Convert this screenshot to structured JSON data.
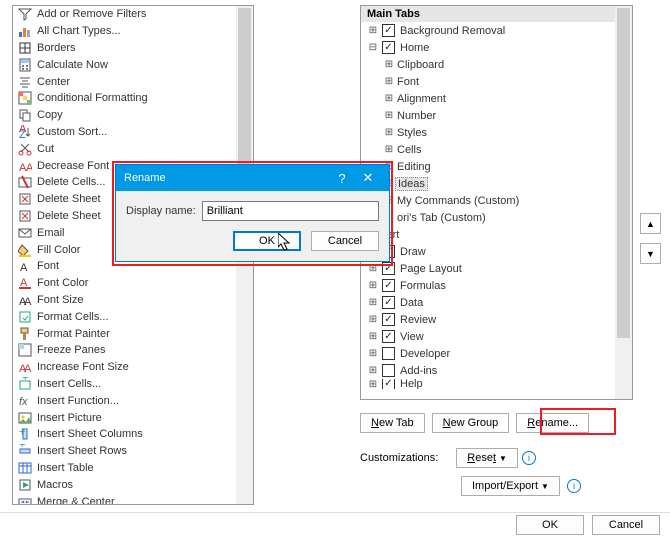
{
  "left_commands": [
    {
      "label": "Add or Remove Filters",
      "icon": "filter"
    },
    {
      "label": "All Chart Types...",
      "icon": "chart"
    },
    {
      "label": "Borders",
      "icon": "borders",
      "hasArrow": true
    },
    {
      "label": "Calculate Now",
      "icon": "calc"
    },
    {
      "label": "Center",
      "icon": "center"
    },
    {
      "label": "Conditional Formatting",
      "icon": "condfmt",
      "hasArrow": true
    },
    {
      "label": "Copy",
      "icon": "copy"
    },
    {
      "label": "Custom Sort...",
      "icon": "sort"
    },
    {
      "label": "Cut",
      "icon": "cut"
    },
    {
      "label": "Decrease Font",
      "icon": "font-dec"
    },
    {
      "label": "Delete Cells...",
      "icon": "del-cells"
    },
    {
      "label": "Delete Sheet",
      "icon": "del-sheet"
    },
    {
      "label": "Delete Sheet",
      "icon": "del-sheet2"
    },
    {
      "label": "Email",
      "icon": "email"
    },
    {
      "label": "Fill Color",
      "icon": "fill"
    },
    {
      "label": "Font",
      "icon": "font"
    },
    {
      "label": "Font Color",
      "icon": "font-color"
    },
    {
      "label": "Font Size",
      "icon": "font-size"
    },
    {
      "label": "Format Cells...",
      "icon": "format-cells"
    },
    {
      "label": "Format Painter",
      "icon": "painter"
    },
    {
      "label": "Freeze Panes",
      "icon": "freeze",
      "hasArrow": true
    },
    {
      "label": "Increase Font Size",
      "icon": "font-inc"
    },
    {
      "label": "Insert Cells...",
      "icon": "ins-cells"
    },
    {
      "label": "Insert Function...",
      "icon": "fx"
    },
    {
      "label": "Insert Picture",
      "icon": "picture"
    },
    {
      "label": "Insert Sheet Columns",
      "icon": "ins-cols"
    },
    {
      "label": "Insert Sheet Rows",
      "icon": "ins-rows"
    },
    {
      "label": "Insert Table",
      "icon": "ins-table"
    },
    {
      "label": "Macros",
      "icon": "macros",
      "hasArrow": true
    },
    {
      "label": "Merge & Center",
      "icon": "merge",
      "hasArrow": true
    }
  ],
  "tree": {
    "title": "Main Tabs",
    "items": [
      {
        "indent": 0,
        "toggle": "+",
        "chk": true,
        "label": "Background Removal"
      },
      {
        "indent": 0,
        "toggle": "−",
        "chk": true,
        "label": "Home"
      },
      {
        "indent": 1,
        "toggle": "+",
        "label": "Clipboard"
      },
      {
        "indent": 1,
        "toggle": "+",
        "label": "Font"
      },
      {
        "indent": 1,
        "toggle": "+",
        "label": "Alignment"
      },
      {
        "indent": 1,
        "toggle": "+",
        "label": "Number"
      },
      {
        "indent": 1,
        "toggle": "+",
        "label": "Styles"
      },
      {
        "indent": 1,
        "toggle": "+",
        "label": "Cells"
      },
      {
        "indent": 1,
        "toggle": "+",
        "label": "Editing"
      },
      {
        "indent": 1,
        "toggle": "+",
        "label": "Ideas",
        "selected": true
      },
      {
        "indent": 1,
        "toggle": "+",
        "label": "My Commands (Custom)"
      },
      {
        "indent": 1,
        "toggle": "",
        "nochk": true,
        "label": "ori's Tab (Custom)",
        "trunc": true
      },
      {
        "indent": 0,
        "toggle": "",
        "nochk": true,
        "label": "sert",
        "trunc": true
      },
      {
        "indent": 0,
        "toggle": "+",
        "chk": true,
        "label": "Draw"
      },
      {
        "indent": 0,
        "toggle": "+",
        "chk": true,
        "label": "Page Layout"
      },
      {
        "indent": 0,
        "toggle": "+",
        "chk": true,
        "label": "Formulas"
      },
      {
        "indent": 0,
        "toggle": "+",
        "chk": true,
        "label": "Data"
      },
      {
        "indent": 0,
        "toggle": "+",
        "chk": true,
        "label": "Review"
      },
      {
        "indent": 0,
        "toggle": "+",
        "chk": true,
        "label": "View"
      },
      {
        "indent": 0,
        "toggle": "+",
        "chk": false,
        "label": "Developer"
      },
      {
        "indent": 0,
        "toggle": "+",
        "chk": false,
        "label": "Add-ins"
      },
      {
        "indent": 0,
        "toggle": "+",
        "chk": true,
        "label": "Help",
        "partial": true
      }
    ]
  },
  "buttons": {
    "new_tab": "New Tab",
    "new_group": "New Group",
    "rename": "Rename...",
    "customizations": "Customizations:",
    "reset": "Reset",
    "import_export": "Import/Export",
    "ok": "OK",
    "cancel": "Cancel"
  },
  "dialog": {
    "title": "Rename",
    "field_label": "Display name:",
    "value": "Brilliant",
    "ok": "OK",
    "cancel": "Cancel"
  }
}
